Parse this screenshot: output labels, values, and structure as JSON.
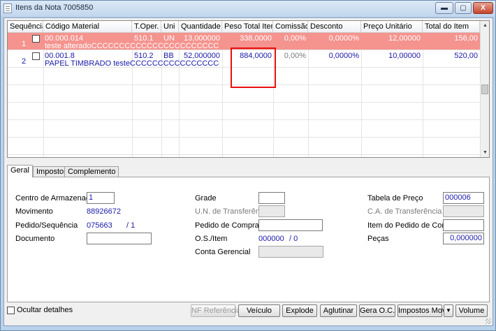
{
  "window": {
    "title": "Itens da Nota 7005850",
    "minimize_label": "▬",
    "maximize_label": "▢",
    "close_label": "X"
  },
  "grid": {
    "columns": [
      "Sequência",
      "Código Material",
      "T.Oper.",
      "Uni",
      "Quantidade",
      "Peso Total Item",
      "Comissão",
      "Desconto",
      "Preço Unitário",
      "Total do Item"
    ],
    "rows": [
      {
        "seq": "1",
        "code": "00.000.014",
        "toper": "510.1",
        "uni": "UN",
        "qtd": "13,000000",
        "peso": "338,0000",
        "comissao": "0,00%",
        "desconto": "0,0000%",
        "preco": "12,00000",
        "total": "156,00",
        "description": "teste alteradoCCCCCCCCCCCCCCCCCCCCCCCCCCCCCCCCCCCC(",
        "selected": true
      },
      {
        "seq": "2",
        "code": "00.001.8",
        "toper": "510.2",
        "uni": "BB",
        "qtd": "52,000000",
        "peso": "884,0000",
        "comissao": "0,00%",
        "desconto": "0,0000%",
        "preco": "10,00000",
        "total": "520,00",
        "description": "PAPEL TIMBRADO testeCCCCCCCCCCCCCCCCCCCCCCCCCCCC",
        "selected": false
      }
    ]
  },
  "tabs": [
    "Geral",
    "Impostos",
    "Complemento"
  ],
  "form": {
    "centro_label": "Centro de Armazenagem",
    "centro_value": "1",
    "movimento_label": "Movimento",
    "movimento_value": "88926672",
    "pedido_seq_label": "Pedido/Sequência",
    "pedido_value": "075663",
    "sequencia_value": "/ 1",
    "documento_label": "Documento",
    "documento_value": "",
    "grade_label": "Grade",
    "grade_value": "",
    "un_transf_label": "U.N. de Transferência",
    "un_transf_value": "",
    "pedido_compra_label": "Pedido de Compra",
    "pedido_compra_value": "",
    "os_item_label": "O.S./Item",
    "os_value": "000000",
    "item_value": "/ 0",
    "conta_label": "Conta Gerencial",
    "conta_value": "",
    "tabela_preco_label": "Tabela de Preço",
    "tabela_preco_value": "000006",
    "ca_transf_label": "C.A. de Transferência",
    "ca_transf_value": "",
    "item_pedido_label": "Item do Pedido de Compra",
    "item_pedido_value": "",
    "pecas_label": "Peças",
    "pecas_value": "0,000000"
  },
  "footer": {
    "ocultar_label": "Ocultar detalhes",
    "buttons": {
      "nf_referencia": "NF Referência",
      "veiculo": "Veículo",
      "explode": "Explode",
      "aglutinar": "Aglutinar",
      "gera_oc": "Gera O.C.",
      "impostos_movto": "Impostos Movto",
      "dropdown": "▼",
      "volume": "Volume"
    }
  }
}
